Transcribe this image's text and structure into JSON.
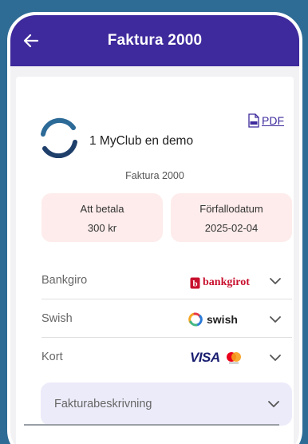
{
  "header": {
    "title": "Faktura 2000"
  },
  "organization": {
    "name": "1 MyClub en demo"
  },
  "pdf": {
    "label": "PDF"
  },
  "invoice": {
    "title": "Faktura 2000"
  },
  "amount": {
    "label": "Att betala",
    "value": "300 kr"
  },
  "due_date": {
    "label": "Förfallodatum",
    "value": "2025-02-04"
  },
  "payment_methods": [
    {
      "label": "Bankgiro",
      "logo_text": "bankgirot",
      "icon": "bankgirot-logo"
    },
    {
      "label": "Swish",
      "logo_text": "swish",
      "icon": "swish-logo"
    },
    {
      "label": "Kort",
      "logo_text": "VISA",
      "icon": "visa-mastercard-logo"
    }
  ],
  "description": {
    "label": "Fakturabeskrivning"
  },
  "colors": {
    "header_bg": "#3e2a9c",
    "page_bg": "#2e6c96",
    "info_box_bg": "#fdeceb",
    "description_bg": "#ecebfa",
    "bankgirot_red": "#c8102e",
    "visa_blue": "#1a1f71"
  }
}
